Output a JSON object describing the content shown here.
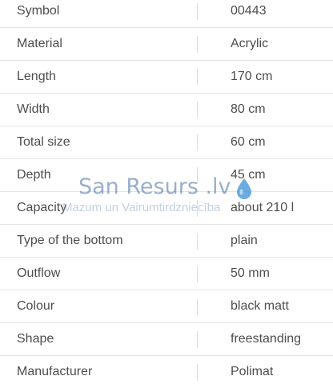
{
  "specs": [
    {
      "label": "Symbol",
      "value": "00443"
    },
    {
      "label": "Material",
      "value": "Acrylic"
    },
    {
      "label": "Length",
      "value": "170 cm"
    },
    {
      "label": "Width",
      "value": "80 cm"
    },
    {
      "label": "Total size",
      "value": "60 cm"
    },
    {
      "label": "Depth",
      "value": "45 cm"
    },
    {
      "label": "Capacity",
      "value": "about 210 l"
    },
    {
      "label": "Type of the bottom",
      "value": "plain"
    },
    {
      "label": "Outflow",
      "value": "50 mm"
    },
    {
      "label": "Colour",
      "value": "black matt"
    },
    {
      "label": "Shape",
      "value": "freestanding"
    },
    {
      "label": "Manufacturer",
      "value": "Polimat"
    }
  ],
  "watermark": {
    "brand": "San Resurs .lv",
    "tagline": "Mazum un Vairumtirdzniecība",
    "icon": "water-drop-icon",
    "drop_color": "#3a8fd6"
  }
}
